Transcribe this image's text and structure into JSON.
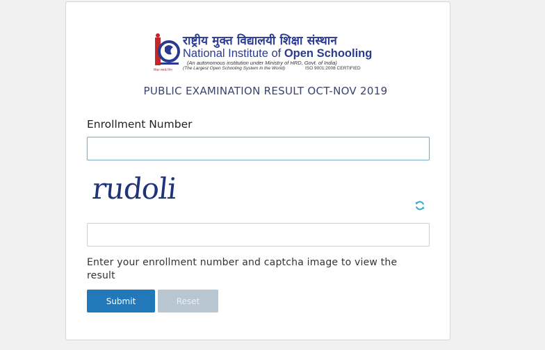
{
  "logo": {
    "hindi_name": "राष्ट्रीय मुक्त विद्यालयी शिक्षा संस्थान",
    "english_name_prefix": "National Institute of ",
    "english_name_bold": "Open Schooling",
    "subtitle": "(An autonomous institution under Ministry of HRD, Govt. of India)",
    "tagline": "(The Largest Open Schooling System in the World)",
    "iso": "ISO 9001:2008 CERTIFIED",
    "emblem_tag": "शिक्षा सबके लिए",
    "colors": {
      "brand_blue": "#2a3a8f",
      "brand_red": "#c0282d"
    }
  },
  "page": {
    "title": "PUBLIC EXAMINATION RESULT OCT-NOV 2019"
  },
  "form": {
    "enrollment_label": "Enrollment Number",
    "enrollment_value": "",
    "captcha_text": "rudoli",
    "captcha_value": "",
    "refresh_icon": "refresh-icon",
    "hint": "Enter your enrollment number and captcha image to view the result",
    "submit_label": "Submit",
    "reset_label": "Reset",
    "colors": {
      "submit": "#2378b9",
      "reset": "#b8c6d1",
      "refresh": "#3aa6c8"
    }
  }
}
